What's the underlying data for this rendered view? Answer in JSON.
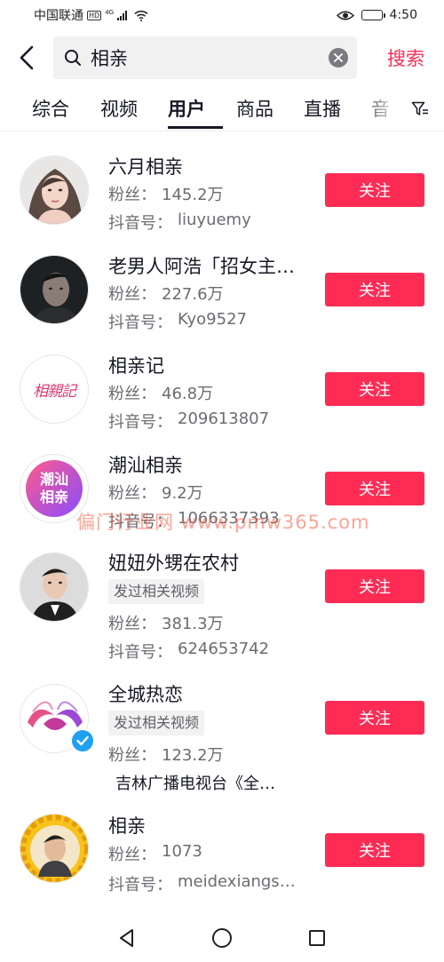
{
  "status_bar": {
    "carrier": "中国联通",
    "hd": "HD",
    "network": "4G",
    "time": "4:50",
    "battery_level": 0.55
  },
  "search": {
    "query": "相亲",
    "placeholder": "",
    "submit_label": "搜索"
  },
  "tabs": {
    "active": "用户",
    "items": [
      "综合",
      "视频",
      "用户",
      "商品",
      "直播",
      "音"
    ]
  },
  "follow_label": "关注",
  "fans_label": "粉丝：",
  "douyin_label": "抖音号：",
  "users": [
    {
      "name": "六月相亲",
      "fans": "145.2万",
      "douyin_id": "liuyuemy",
      "avatar": "portrait-woman"
    },
    {
      "name": "老男人阿浩「招女主…",
      "fans": "227.6万",
      "douyin_id": "Kyo9527",
      "avatar": "portrait-man-dark"
    },
    {
      "name": "相亲记",
      "fans": "46.8万",
      "douyin_id": "209613807",
      "avatar": "logo-xiangqinji",
      "avatar_text": "相親記"
    },
    {
      "name": "潮汕相亲",
      "fans": "9.2万",
      "douyin_id": "1066337393",
      "avatar": "logo-chaoshan",
      "avatar_text_1": "潮汕",
      "avatar_text_2": "相亲"
    },
    {
      "name": "妞妞外甥在农村",
      "tag": "发过相关视频",
      "fans": "381.3万",
      "douyin_id": "624653742",
      "avatar": "portrait-young-man"
    },
    {
      "name": "全城热恋",
      "tag": "发过相关视频",
      "fans": "123.2万",
      "description": "吉林广播电视台《全…",
      "avatar": "logo-wings",
      "verified": true
    },
    {
      "name": "相亲",
      "fans": "1073",
      "douyin_id": "meidexiangs…",
      "avatar": "portrait-man-sunflower"
    }
  ],
  "watermark": "偏门行业网 www.pmw365.com",
  "colors": {
    "accent": "#fe2c55",
    "text_primary": "#161823",
    "text_secondary": "#6b6c72",
    "verified": "#20a0f0"
  }
}
